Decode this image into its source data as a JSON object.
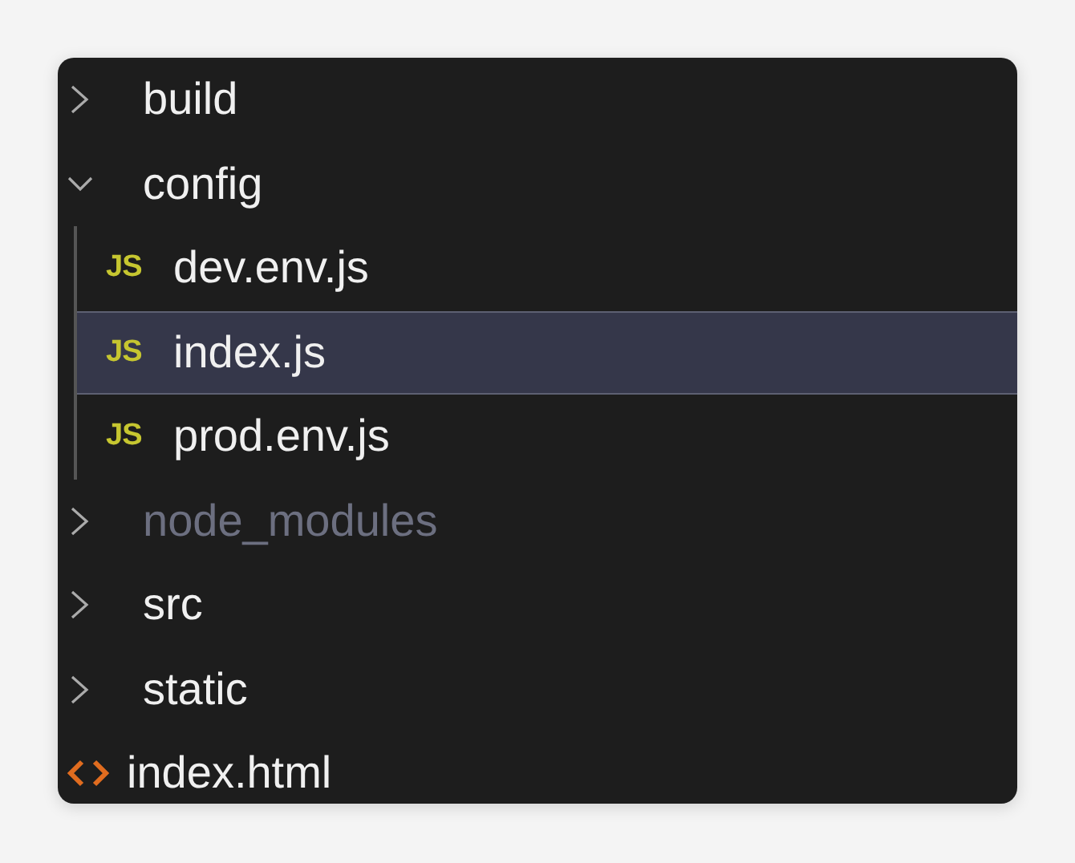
{
  "tree": [
    {
      "kind": "folder",
      "name": "build",
      "expanded": false,
      "selected": false,
      "ignored": false
    },
    {
      "kind": "folder",
      "name": "config",
      "expanded": true,
      "selected": false,
      "ignored": false,
      "children": [
        {
          "kind": "js",
          "icon_text": "JS",
          "name": "dev.env.js",
          "selected": false,
          "ignored": false
        },
        {
          "kind": "js",
          "icon_text": "JS",
          "name": "index.js",
          "selected": true,
          "ignored": false
        },
        {
          "kind": "js",
          "icon_text": "JS",
          "name": "prod.env.js",
          "selected": false,
          "ignored": false
        }
      ]
    },
    {
      "kind": "folder",
      "name": "node_modules",
      "expanded": false,
      "selected": false,
      "ignored": true
    },
    {
      "kind": "folder",
      "name": "src",
      "expanded": false,
      "selected": false,
      "ignored": false
    },
    {
      "kind": "folder",
      "name": "static",
      "expanded": false,
      "selected": false,
      "ignored": false
    },
    {
      "kind": "html",
      "name": "index.html",
      "selected": false,
      "ignored": false
    }
  ]
}
